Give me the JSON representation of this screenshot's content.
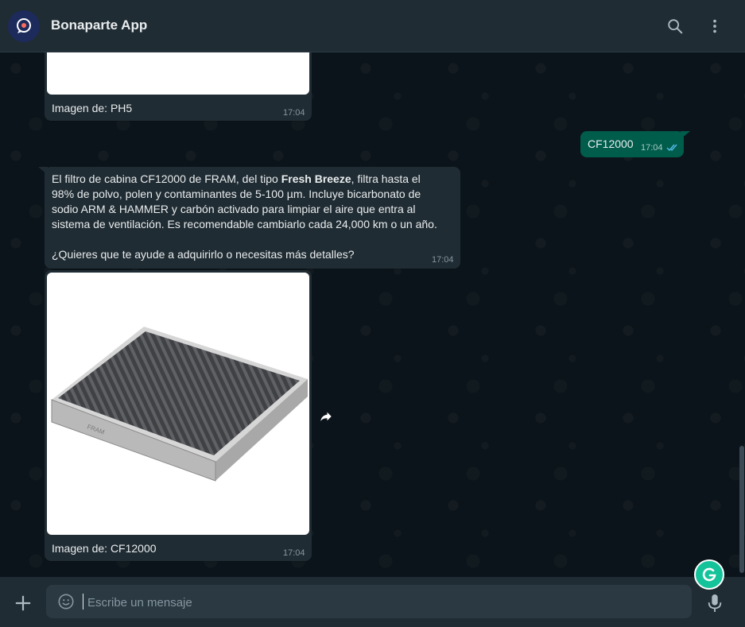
{
  "header": {
    "title": "Bonaparte App",
    "icons": {
      "avatar": "bonaparte-logo",
      "search": "search-icon",
      "menu": "kebab-menu-icon"
    }
  },
  "messages": [
    {
      "type": "image",
      "direction": "in",
      "caption": "Imagen de: PH5",
      "time": "17:04"
    },
    {
      "type": "text",
      "direction": "out",
      "text": "CF12000",
      "time": "17:04",
      "status": "read"
    },
    {
      "type": "text",
      "direction": "in",
      "lines": [
        {
          "before": "El filtro de cabina CF12000 de FRAM, del tipo ",
          "bold": "Fresh Breeze",
          "after": ", filtra hasta el"
        },
        "98% de polvo, polen y contaminantes de 5-100 µm. Incluye bicarbonato de",
        "sodio ARM & HAMMER y carbón activado para limpiar el aire que entra al",
        "sistema de ventilación. Es recomendable cambiarlo cada 24,000 km o un año.",
        "",
        "¿Quieres que te ayude a adquirirlo o necesitas más detalles?"
      ],
      "time": "17:04"
    },
    {
      "type": "image",
      "direction": "in",
      "caption": "Imagen de: CF12000",
      "time": "17:04",
      "image": "cabin-air-filter"
    }
  ],
  "composer": {
    "placeholder": "Escribe un mensaje"
  },
  "colors": {
    "header_bg": "#202c33",
    "chat_bg": "#0b141a",
    "bubble_in": "#202c33",
    "bubble_out": "#005c4b",
    "read_tick": "#53bdeb",
    "grammarly": "#15c39a"
  }
}
